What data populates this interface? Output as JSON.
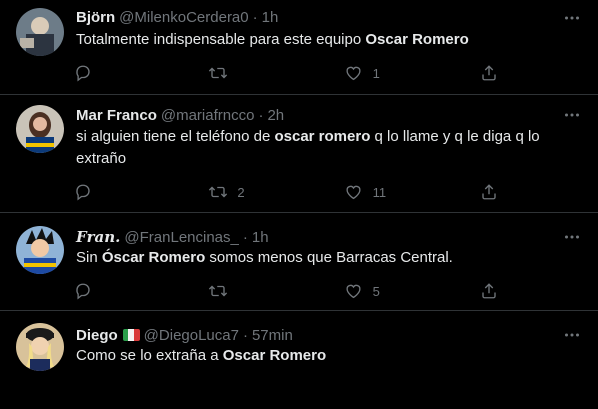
{
  "tweets": [
    {
      "name": "Björn",
      "handle": "@MilenkoCerdera0",
      "sep": "·",
      "time": "1h",
      "text_before": "Totalmente indispensable para este equipo ",
      "text_bold": "Oscar Romero",
      "text_after": "",
      "replies": "",
      "retweets": "",
      "likes": "1"
    },
    {
      "name": "Mar Franco",
      "handle": "@mariafrncco",
      "sep": "·",
      "time": "2h",
      "text_before": "si alguien tiene el teléfono de ",
      "text_bold": "oscar romero",
      "text_after": " q lo llame y q le diga q lo extraño",
      "replies": "",
      "retweets": "2",
      "likes": "11"
    },
    {
      "name": "𝑭𝒓𝒂𝒏.",
      "handle": "@FranLencinas_",
      "sep": "·",
      "time": "1h",
      "text_before": "Sin ",
      "text_bold": "Óscar Romero",
      "text_after": " somos menos que Barracas Central.",
      "replies": "",
      "retweets": "",
      "likes": "5"
    },
    {
      "name": "Diego",
      "flag": "italy-flag",
      "handle": "@DiegoLuca7",
      "sep": "·",
      "time": "57min",
      "text_before": "Como se lo extraña a ",
      "text_bold": "Oscar Romero",
      "text_after": "",
      "replies": "",
      "retweets": "",
      "likes": ""
    }
  ],
  "icons": {
    "reply": "reply-icon",
    "retweet": "retweet-icon",
    "like": "heart-icon",
    "share": "share-icon",
    "more": "more-icon"
  },
  "colors": {
    "background": "#000000",
    "text": "#e7e9ea",
    "muted": "#71767b",
    "divider": "#2f3336"
  }
}
